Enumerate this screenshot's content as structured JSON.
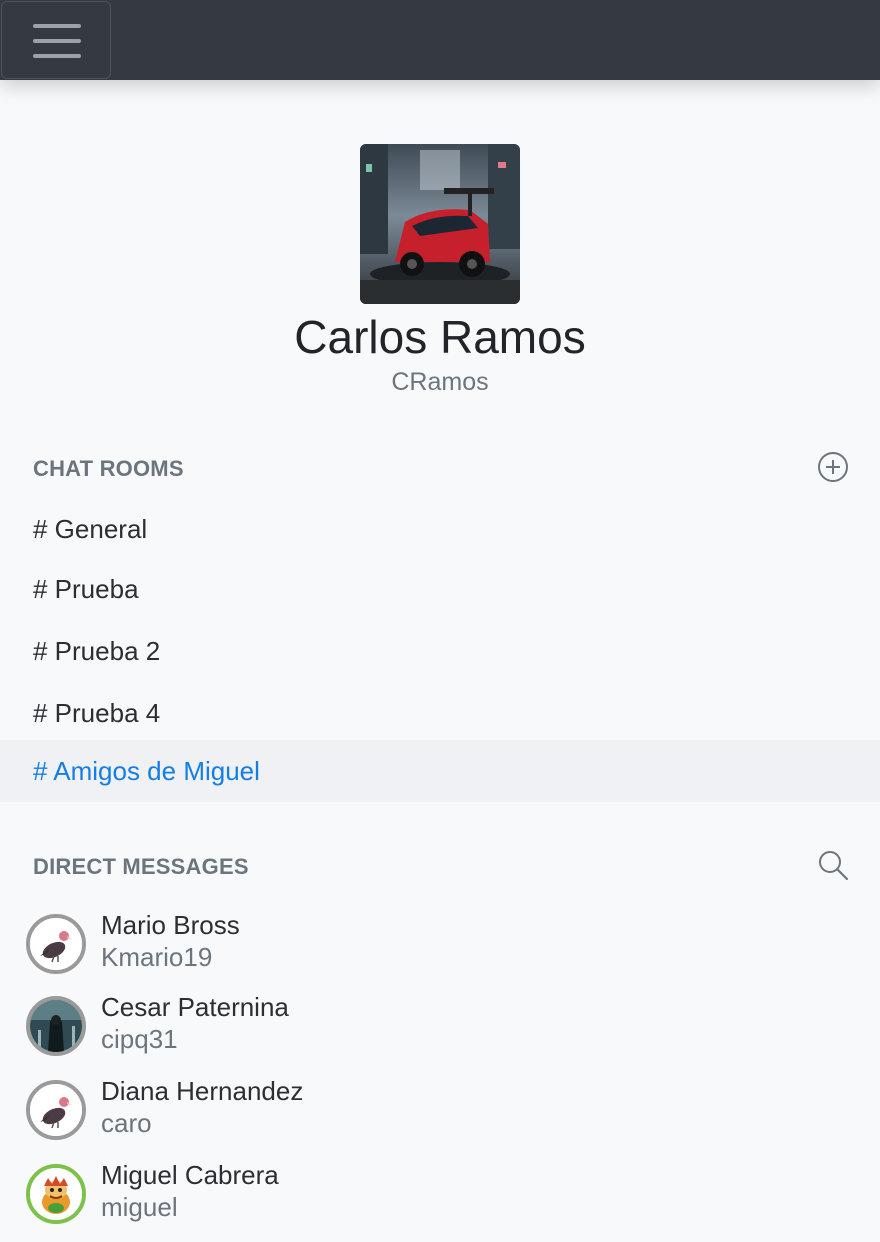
{
  "profile": {
    "name": "Carlos Ramos",
    "username": "CRamos"
  },
  "chat_rooms": {
    "title": "CHAT ROOMS",
    "add_icon": "plus-circle-icon",
    "rooms": [
      {
        "label": "# General",
        "active": false
      },
      {
        "label": "# Prueba",
        "active": false
      },
      {
        "label": "# Prueba 2",
        "active": false
      },
      {
        "label": "# Prueba 4",
        "active": false
      },
      {
        "label": "# Amigos de Miguel",
        "active": true
      }
    ]
  },
  "direct_messages": {
    "title": "DIRECT MESSAGES",
    "search_icon": "search-icon",
    "users": [
      {
        "name": "Mario Bross",
        "username": "Kmario19"
      },
      {
        "name": "Cesar Paternina",
        "username": "cipq31"
      },
      {
        "name": "Diana Hernandez",
        "username": "caro"
      },
      {
        "name": "Miguel Cabrera",
        "username": "miguel"
      }
    ]
  },
  "colors": {
    "topbar": "#343a40",
    "active_room": "#137fe6",
    "active_room_bg": "#eff1f4",
    "muted": "#6c757d"
  }
}
